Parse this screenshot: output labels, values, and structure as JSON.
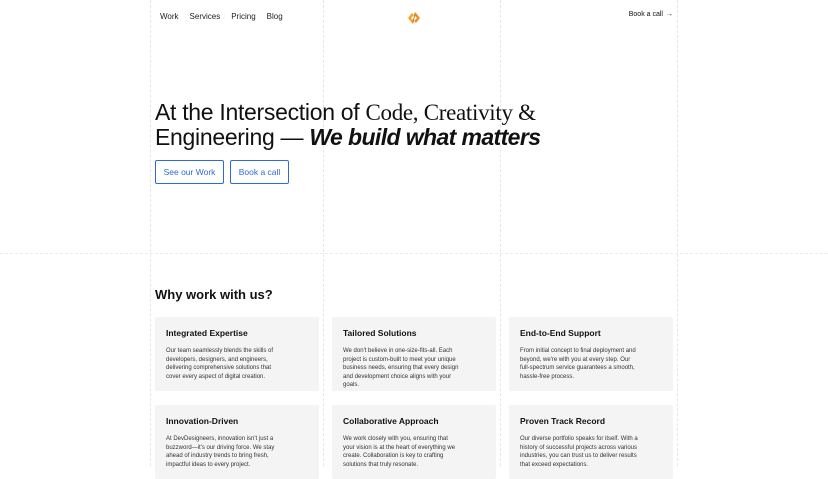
{
  "nav": {
    "items": [
      {
        "label": "Work"
      },
      {
        "label": "Services"
      },
      {
        "label": "Pricing"
      },
      {
        "label": "Blog"
      }
    ],
    "book_call": "Book a call",
    "book_call_arrow": "→"
  },
  "hero": {
    "line1_plain": "At the Intersection of ",
    "line1_serif": "Code, Creativity &",
    "line2_plain": "Engineering — ",
    "line2_bold": "We build what matters",
    "buttons": {
      "work": "See our Work",
      "call": "Book a call"
    }
  },
  "why": {
    "title": "Why work with us?",
    "cards": [
      {
        "title": "Integrated Expertise",
        "text": "Our team seamlessly blends the skills of developers, designers, and engineers, delivering comprehensive solutions that cover every aspect of digital creation."
      },
      {
        "title": "Tailored Solutions",
        "text": "We don't believe in one-size-fits-all. Each project is custom-built to meet your unique business needs, ensuring that every design and development choice aligns with your goals."
      },
      {
        "title": "End-to-End Support",
        "text": "From initial concept to final deployment and beyond, we're with you at every step. Our full-spectrum service guarantees a smooth, hassle-free process."
      },
      {
        "title": "Innovation-Driven",
        "text": "At DevDesigneers, innovation isn't just a buzzword—it's our driving force. We stay ahead of industry trends to bring fresh, impactful ideas to every project."
      },
      {
        "title": "Collaborative Approach",
        "text": "We work closely with you, ensuring that your vision is at the heart of everything we create. Collaboration is key to crafting solutions that truly resonate."
      },
      {
        "title": "Proven Track Record",
        "text": "Our diverse portfolio speaks for itself. With a history of successful projects across various industries, you can trust us to deliver results that exceed expectations."
      }
    ]
  },
  "colors": {
    "accent": "#2f6bd8",
    "logo_orange": "#f3a52b",
    "card_bg": "#f4f4f5"
  }
}
